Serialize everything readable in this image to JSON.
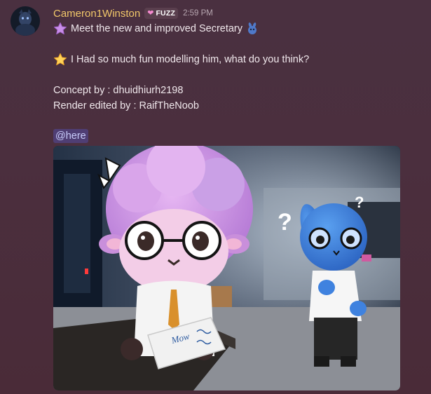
{
  "message": {
    "author": "Cameron1Winston",
    "tag": {
      "icon": "pink-heart-icon",
      "label": "FUZZ"
    },
    "timestamp": "2:59 PM",
    "lines": [
      {
        "emoji": "purple-star-emoji",
        "text": "Meet the new and improved Secretary",
        "trailing_emoji": "blue-character-emoji"
      },
      {
        "emoji": "yellow-star-emoji",
        "text": "I Had so much fun modelling him, what do you think?"
      },
      {
        "text": "Concept by : dhuidhiurh2198"
      },
      {
        "text": "Render edited by : RaifTheNoob"
      }
    ],
    "mention": "@here",
    "attachment": {
      "type": "image",
      "subject": "pink-sheep-with-glasses-and-blue-rabbit-render",
      "sign_text": "Mow"
    }
  },
  "colors": {
    "username": "#f2c86a",
    "background": "#4a2f3d",
    "text": "#f0e8ec",
    "timestamp": "#b7a6b0",
    "mention": "#c9cdfb"
  }
}
